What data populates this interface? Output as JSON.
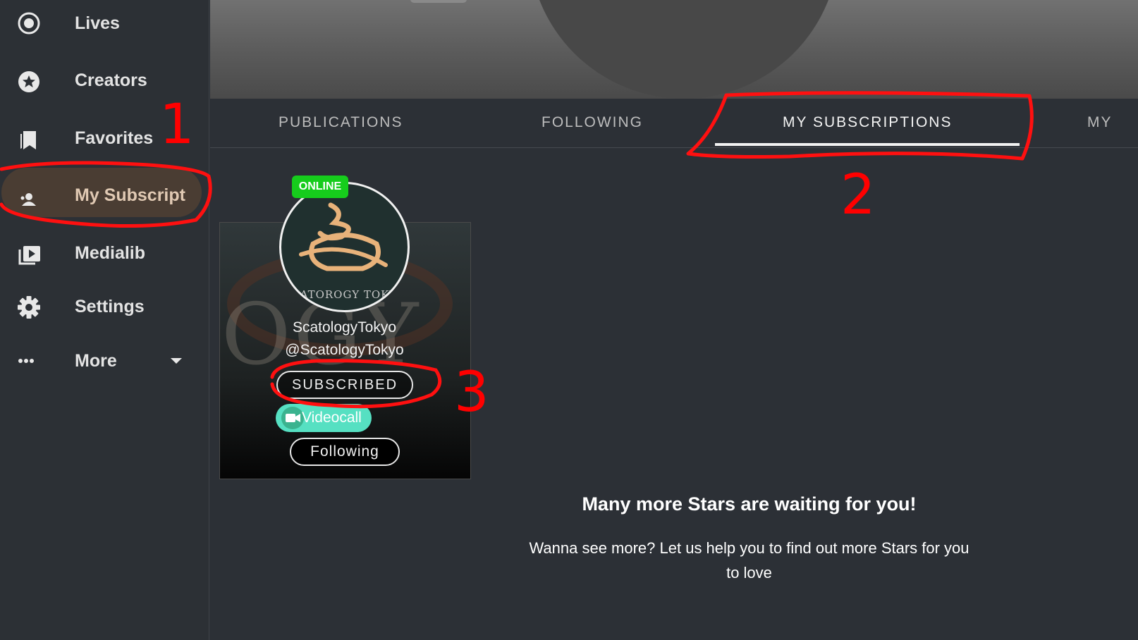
{
  "sidebar": {
    "items": [
      {
        "label": "Lives",
        "icon": "record-icon"
      },
      {
        "label": "Creators",
        "icon": "star-badge-icon"
      },
      {
        "label": "Favorites",
        "icon": "bookmarks-icon"
      },
      {
        "label": "My Subscript",
        "icon": "subscriptions-people-icon",
        "active": true
      },
      {
        "label": "Medialib",
        "icon": "media-library-icon"
      },
      {
        "label": "Settings",
        "icon": "gear-icon"
      },
      {
        "label": "More",
        "icon": "more-dots-icon",
        "dropdown": "chevron-down-icon"
      }
    ]
  },
  "tabs": {
    "items": [
      "PUBLICATIONS",
      "FOLLOWING",
      "MY SUBSCRIPTIONS",
      "MY"
    ],
    "active": "MY SUBSCRIPTIONS"
  },
  "card": {
    "status": "ONLINE",
    "name": "ScatologyTokyo",
    "handle": "@ScatologyTokyo",
    "subscribed_label": "SUBSCRIBED",
    "videocall_label": "Videocall",
    "following_label": "Following",
    "avatar_caption": "SCATOROGY TOKYO",
    "background_text": "OGY"
  },
  "promo": {
    "title": "Many more Stars are waiting for you!",
    "text": "Wanna see more? Let us help you to find out more Stars for you to love"
  },
  "annotations": {
    "labels": [
      "1",
      "2",
      "3"
    ],
    "color": "#ff0000"
  },
  "colors": {
    "accent_active_bg": "#4a3d33",
    "online_green": "#16cc1c",
    "videocall_teal": "#56e0c2"
  }
}
